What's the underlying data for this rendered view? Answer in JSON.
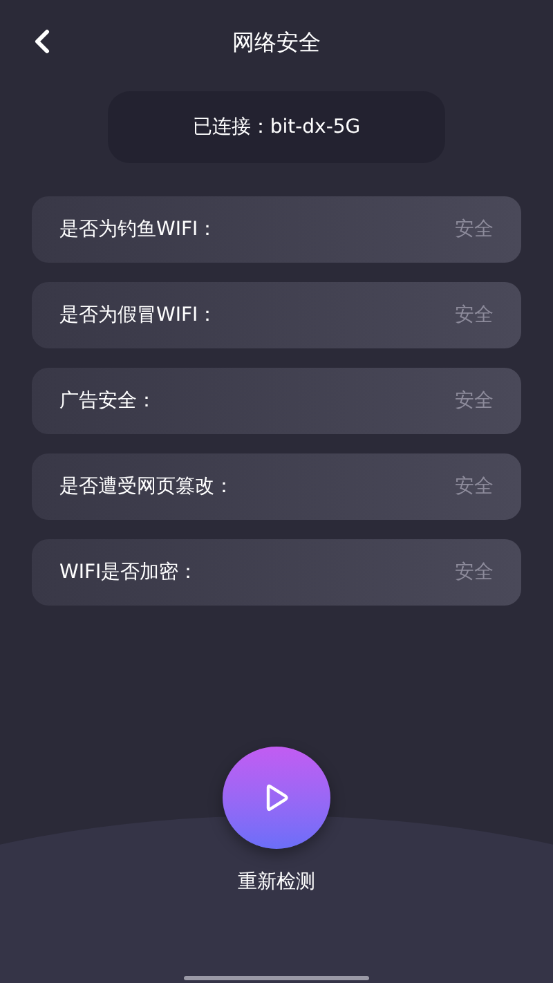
{
  "header": {
    "title": "网络安全"
  },
  "connection": {
    "text": "已连接：bit-dx-5G"
  },
  "checks": [
    {
      "label": "是否为钓鱼WIFI：",
      "result": "安全"
    },
    {
      "label": "是否为假冒WIFI：",
      "result": "安全"
    },
    {
      "label": "广告安全：",
      "result": "安全"
    },
    {
      "label": "是否遭受网页篡改：",
      "result": "安全"
    },
    {
      "label": "WIFI是否加密：",
      "result": "安全"
    }
  ],
  "action": {
    "label": "重新检测"
  }
}
